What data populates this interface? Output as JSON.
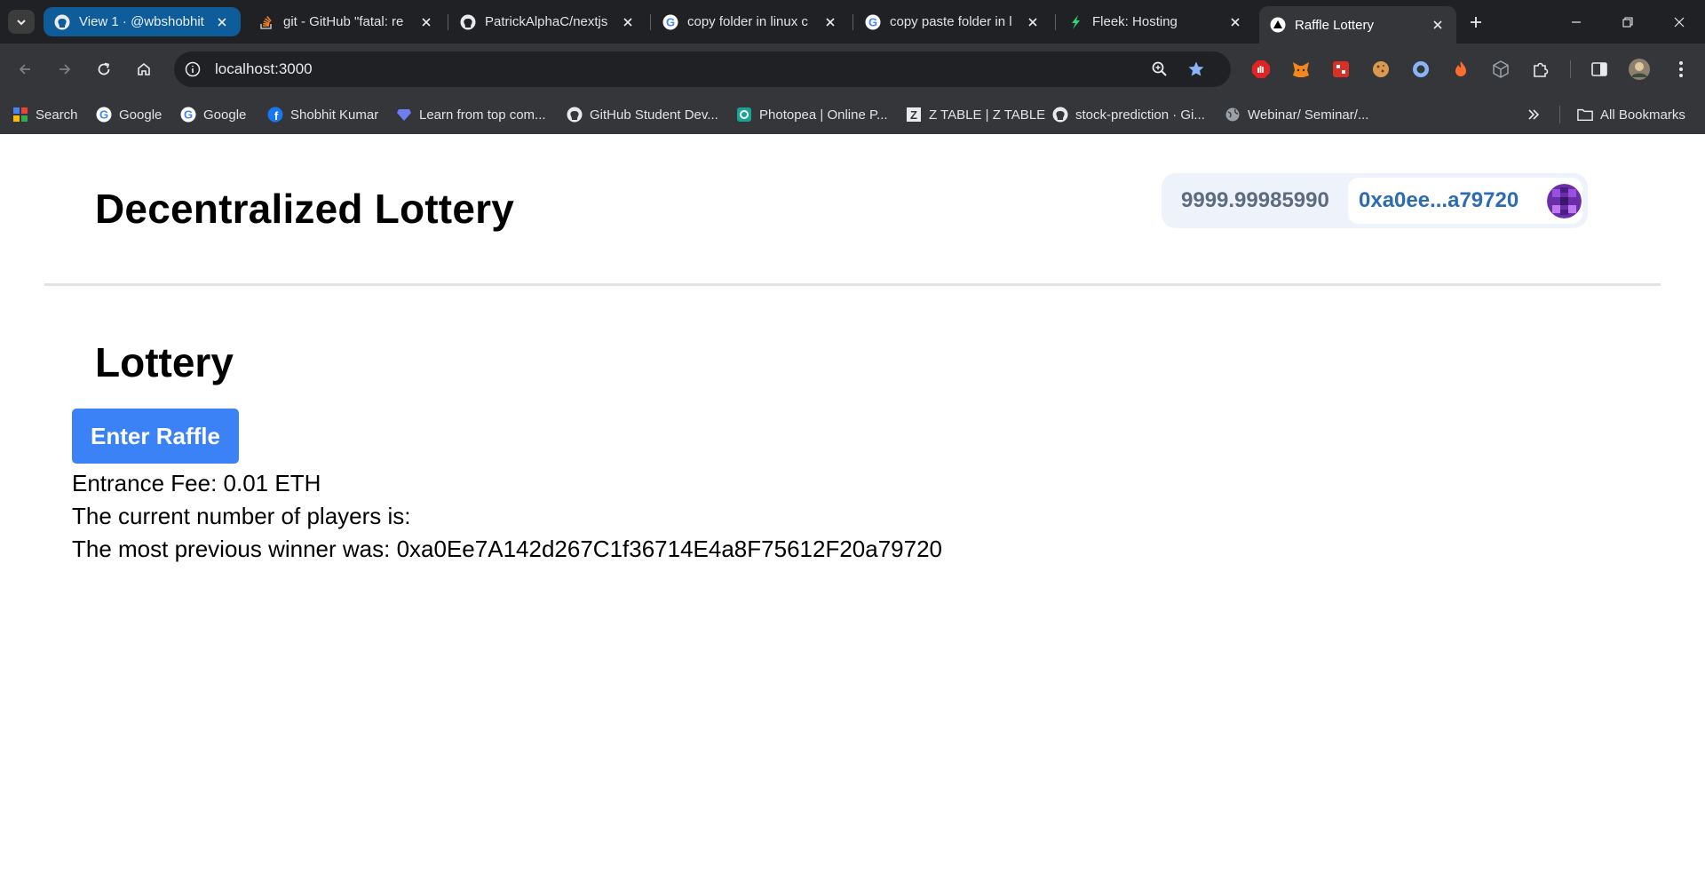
{
  "browser": {
    "tabs": [
      {
        "title": "View 1 · @wbshobhit",
        "favicon": "github-icon"
      },
      {
        "title": "git - GitHub \"fatal: re",
        "favicon": "stackoverflow-icon"
      },
      {
        "title": "PatrickAlphaC/nextjs",
        "favicon": "github-icon"
      },
      {
        "title": "copy folder in linux c",
        "favicon": "google-icon"
      },
      {
        "title": "copy paste folder in l",
        "favicon": "google-icon"
      },
      {
        "title": "Fleek: Hosting",
        "favicon": "fleek-icon"
      },
      {
        "title": "Raffle Lottery",
        "favicon": "nextjs-icon"
      }
    ],
    "url": "localhost:3000",
    "bookmarks": [
      {
        "label": "Search"
      },
      {
        "label": "Google"
      },
      {
        "label": "Google"
      },
      {
        "label": "Shobhit Kumar"
      },
      {
        "label": "Learn from top com..."
      },
      {
        "label": "GitHub Student Dev..."
      },
      {
        "label": "Photopea | Online P..."
      },
      {
        "label": "Z TABLE | Z TABLE"
      },
      {
        "label": "stock-prediction · Gi..."
      },
      {
        "label": "Webinar/ Seminar/..."
      }
    ],
    "all_bookmarks_label": "All Bookmarks",
    "accent": "#0f5c9a"
  },
  "page": {
    "title": "Decentralized Lottery",
    "wallet": {
      "balance": "9999.99985990",
      "address": "0xa0ee...a79720"
    },
    "section_title": "Lottery",
    "enter_button": "Enter Raffle",
    "entrance_fee": "Entrance Fee: 0.01 ETH",
    "players_line": "The current number of players is:",
    "winner_line": "The most previous winner was: 0xa0Ee7A142d267C1f36714E4a8F75612F20a79720",
    "button_color": "#3b82f6"
  }
}
